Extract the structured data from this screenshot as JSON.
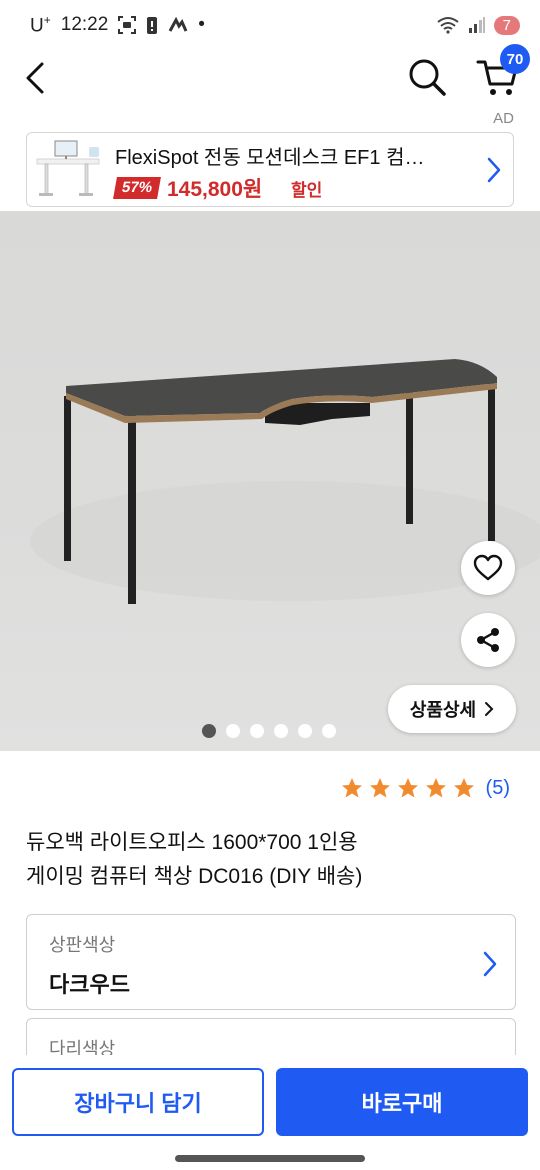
{
  "status_bar": {
    "carrier": "U",
    "carrier_sup": "+",
    "time": "12:22",
    "dot": "•",
    "battery": "7"
  },
  "header": {
    "cart_count": "70"
  },
  "ad": {
    "label": "AD",
    "title": "FlexiSpot 전동 모션데스크 EF1 컴…",
    "discount": "57%",
    "price": "145,800원",
    "sale_text": "할인"
  },
  "gallery": {
    "detail_label": "상품상세",
    "dot_count": 6,
    "active_index": 0
  },
  "rating": {
    "stars": 5,
    "review_count": "(5)",
    "star_color": "#f28a2e"
  },
  "product": {
    "title_line1": "듀오백 라이트오피스 1600*700 1인용",
    "title_line2": "게이밍 컴퓨터 책상 DC016 (DIY 배송)"
  },
  "options": [
    {
      "label": "상판색상",
      "value": "다크우드"
    },
    {
      "label": "다리색상"
    }
  ],
  "actions": {
    "add_to_cart": "장바구니 담기",
    "buy_now": "바로구매"
  },
  "colors": {
    "accent": "#1f5bf3",
    "sale_red": "#d12b2b"
  }
}
